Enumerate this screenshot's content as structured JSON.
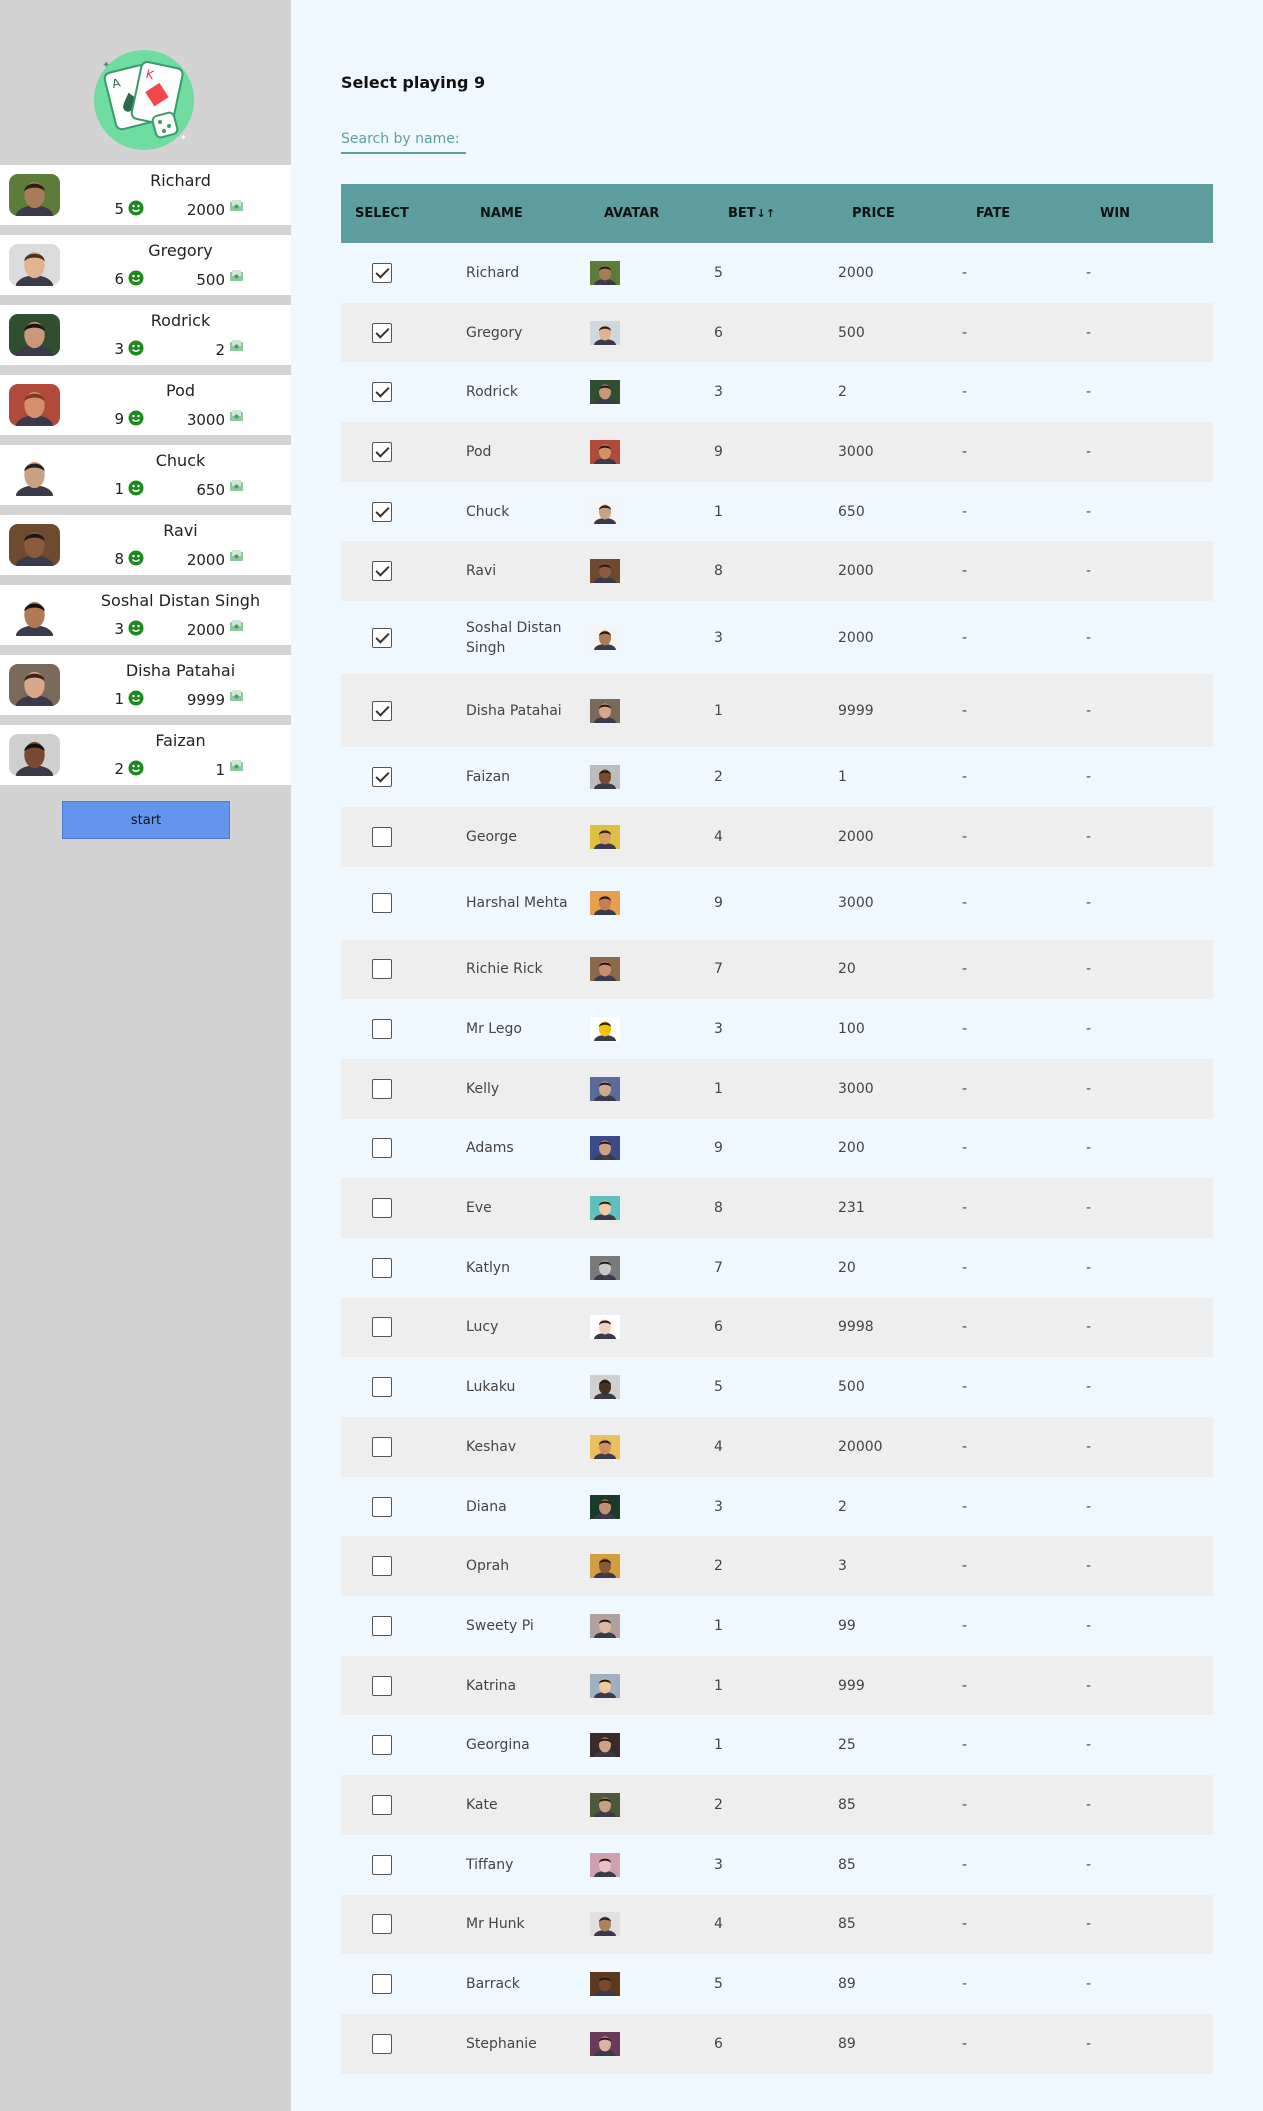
{
  "sidebar": {
    "players": [
      {
        "name": "Richard",
        "bet": "5",
        "price": "2000",
        "skin": "#a87b5a",
        "bg": "#5d7c3a",
        "hair": "#2b1d12"
      },
      {
        "name": "Gregory",
        "bet": "6",
        "price": "500",
        "skin": "#e3b28e",
        "bg": "#dcdcdc",
        "hair": "#4a3424"
      },
      {
        "name": "Rodrick",
        "bet": "3",
        "price": "2",
        "skin": "#c89878",
        "bg": "#2f4f2f",
        "hair": "#1c1410"
      },
      {
        "name": "Pod",
        "bet": "9",
        "price": "3000",
        "skin": "#d4906a",
        "bg": "#b04a3a",
        "hair": "#7a3c22"
      },
      {
        "name": "Chuck",
        "bet": "1",
        "price": "650",
        "skin": "#c9a080",
        "bg": "#ffffff",
        "hair": "#222222"
      },
      {
        "name": "Ravi",
        "bet": "8",
        "price": "2000",
        "skin": "#8c5a3c",
        "bg": "#6d4a30",
        "hair": "#1a1a1a"
      },
      {
        "name": "Soshal Distan Singh",
        "bet": "3",
        "price": "2000",
        "skin": "#b07a55",
        "bg": "#ffffff",
        "hair": "#111111"
      },
      {
        "name": "Disha Patahai",
        "bet": "1",
        "price": "9999",
        "skin": "#d8a888",
        "bg": "#7a6a5a",
        "hair": "#3a2418"
      },
      {
        "name": "Faizan",
        "bet": "2",
        "price": "1",
        "skin": "#7a4a2e",
        "bg": "#cfcfcf",
        "hair": "#111111"
      }
    ],
    "start_label": "start"
  },
  "main": {
    "title": "Select playing 9",
    "search_placeholder": "Search by name:",
    "columns": [
      "SELECT",
      "NAME",
      "AVATAR",
      "BET",
      "PRICE",
      "FATE",
      "WIN"
    ],
    "sort_icon": "↓↑",
    "rows": [
      {
        "selected": true,
        "name": "Richard",
        "bet": "5",
        "price": "2000",
        "fate": "-",
        "win": "-",
        "skin": "#a87b5a",
        "bg": "#5d7c3a"
      },
      {
        "selected": true,
        "name": "Gregory",
        "bet": "6",
        "price": "500",
        "fate": "-",
        "win": "-",
        "skin": "#e3b28e",
        "bg": "#cfd8dc"
      },
      {
        "selected": true,
        "name": "Rodrick",
        "bet": "3",
        "price": "2",
        "fate": "-",
        "win": "-",
        "skin": "#c89878",
        "bg": "#2f4f2f"
      },
      {
        "selected": true,
        "name": "Pod",
        "bet": "9",
        "price": "3000",
        "fate": "-",
        "win": "-",
        "skin": "#d4906a",
        "bg": "#b04a3a"
      },
      {
        "selected": true,
        "name": "Chuck",
        "bet": "1",
        "price": "650",
        "fate": "-",
        "win": "-",
        "skin": "#c9a080",
        "bg": "#f5f5f5"
      },
      {
        "selected": true,
        "name": "Ravi",
        "bet": "8",
        "price": "2000",
        "fate": "-",
        "win": "-",
        "skin": "#8c5a3c",
        "bg": "#6d4a30"
      },
      {
        "selected": true,
        "name": "Soshal Distan Singh",
        "bet": "3",
        "price": "2000",
        "fate": "-",
        "win": "-",
        "skin": "#b07a55",
        "bg": "#f5f5f5"
      },
      {
        "selected": true,
        "name": "Disha Patahai",
        "bet": "1",
        "price": "9999",
        "fate": "-",
        "win": "-",
        "skin": "#d8a888",
        "bg": "#7a6a5a"
      },
      {
        "selected": true,
        "name": "Faizan",
        "bet": "2",
        "price": "1",
        "fate": "-",
        "win": "-",
        "skin": "#7a4a2e",
        "bg": "#bdbdbd"
      },
      {
        "selected": false,
        "name": "George",
        "bet": "4",
        "price": "2000",
        "fate": "-",
        "win": "-",
        "skin": "#d8a060",
        "bg": "#e0c040"
      },
      {
        "selected": false,
        "name": "Harshal Mehta",
        "bet": "9",
        "price": "3000",
        "fate": "-",
        "win": "-",
        "skin": "#c08050",
        "bg": "#e8a050"
      },
      {
        "selected": false,
        "name": "Richie Rick",
        "bet": "7",
        "price": "20",
        "fate": "-",
        "win": "-",
        "skin": "#c89070",
        "bg": "#8a6a4a"
      },
      {
        "selected": false,
        "name": "Mr Lego",
        "bet": "3",
        "price": "100",
        "fate": "-",
        "win": "-",
        "skin": "#f2c200",
        "bg": "#ffffff"
      },
      {
        "selected": false,
        "name": "Kelly",
        "bet": "1",
        "price": "3000",
        "fate": "-",
        "win": "-",
        "skin": "#d0a890",
        "bg": "#5a6a9a"
      },
      {
        "selected": false,
        "name": "Adams",
        "bet": "9",
        "price": "200",
        "fate": "-",
        "win": "-",
        "skin": "#d0a080",
        "bg": "#3a4a8a"
      },
      {
        "selected": false,
        "name": "Eve",
        "bet": "8",
        "price": "231",
        "fate": "-",
        "win": "-",
        "skin": "#f0c8a8",
        "bg": "#60c0c0"
      },
      {
        "selected": false,
        "name": "Katlyn",
        "bet": "7",
        "price": "20",
        "fate": "-",
        "win": "-",
        "skin": "#c8c8c8",
        "bg": "#7a7a7a"
      },
      {
        "selected": false,
        "name": "Lucy",
        "bet": "6",
        "price": "9998",
        "fate": "-",
        "win": "-",
        "skin": "#f0d0c0",
        "bg": "#ffffff"
      },
      {
        "selected": false,
        "name": "Lukaku",
        "bet": "5",
        "price": "500",
        "fate": "-",
        "win": "-",
        "skin": "#4a3020",
        "bg": "#d0d0d0"
      },
      {
        "selected": false,
        "name": "Keshav",
        "bet": "4",
        "price": "20000",
        "fate": "-",
        "win": "-",
        "skin": "#d09060",
        "bg": "#e8c060"
      },
      {
        "selected": false,
        "name": "Diana",
        "bet": "3",
        "price": "2",
        "fate": "-",
        "win": "-",
        "skin": "#c09070",
        "bg": "#1a3a2a"
      },
      {
        "selected": false,
        "name": "Oprah",
        "bet": "2",
        "price": "3",
        "fate": "-",
        "win": "-",
        "skin": "#8a5a3a",
        "bg": "#d0a040"
      },
      {
        "selected": false,
        "name": "Sweety Pi",
        "bet": "1",
        "price": "99",
        "fate": "-",
        "win": "-",
        "skin": "#e0b8a0",
        "bg": "#b0a0a0"
      },
      {
        "selected": false,
        "name": "Katrina",
        "bet": "1",
        "price": "999",
        "fate": "-",
        "win": "-",
        "skin": "#f0c8a0",
        "bg": "#a0b0c0"
      },
      {
        "selected": false,
        "name": "Georgina",
        "bet": "1",
        "price": "25",
        "fate": "-",
        "win": "-",
        "skin": "#d0a080",
        "bg": "#3a2a2a"
      },
      {
        "selected": false,
        "name": "Kate",
        "bet": "2",
        "price": "85",
        "fate": "-",
        "win": "-",
        "skin": "#c8a080",
        "bg": "#4a5a3a"
      },
      {
        "selected": false,
        "name": "Tiffany",
        "bet": "3",
        "price": "85",
        "fate": "-",
        "win": "-",
        "skin": "#e8c0c8",
        "bg": "#d0a0b0"
      },
      {
        "selected": false,
        "name": "Mr Hunk",
        "bet": "4",
        "price": "85",
        "fate": "-",
        "win": "-",
        "skin": "#b08060",
        "bg": "#e0e0e0"
      },
      {
        "selected": false,
        "name": "Barrack",
        "bet": "5",
        "price": "89",
        "fate": "-",
        "win": "-",
        "skin": "#7a4a30",
        "bg": "#5a3a20"
      },
      {
        "selected": false,
        "name": "Stephanie",
        "bet": "6",
        "price": "89",
        "fate": "-",
        "win": "-",
        "skin": "#e0b0a0",
        "bg": "#6a3a5a"
      }
    ]
  },
  "colors": {
    "sidebar_bg": "#d3d3d3",
    "main_bg": "#f0f8ff",
    "header_bg": "#5f9ea0",
    "start_button": "#6495ed",
    "smile_green": "#1a8a1a"
  },
  "icons": {
    "logo": "playing-cards-dice-logo",
    "bet": "smiley-icon",
    "price": "money-icon"
  }
}
